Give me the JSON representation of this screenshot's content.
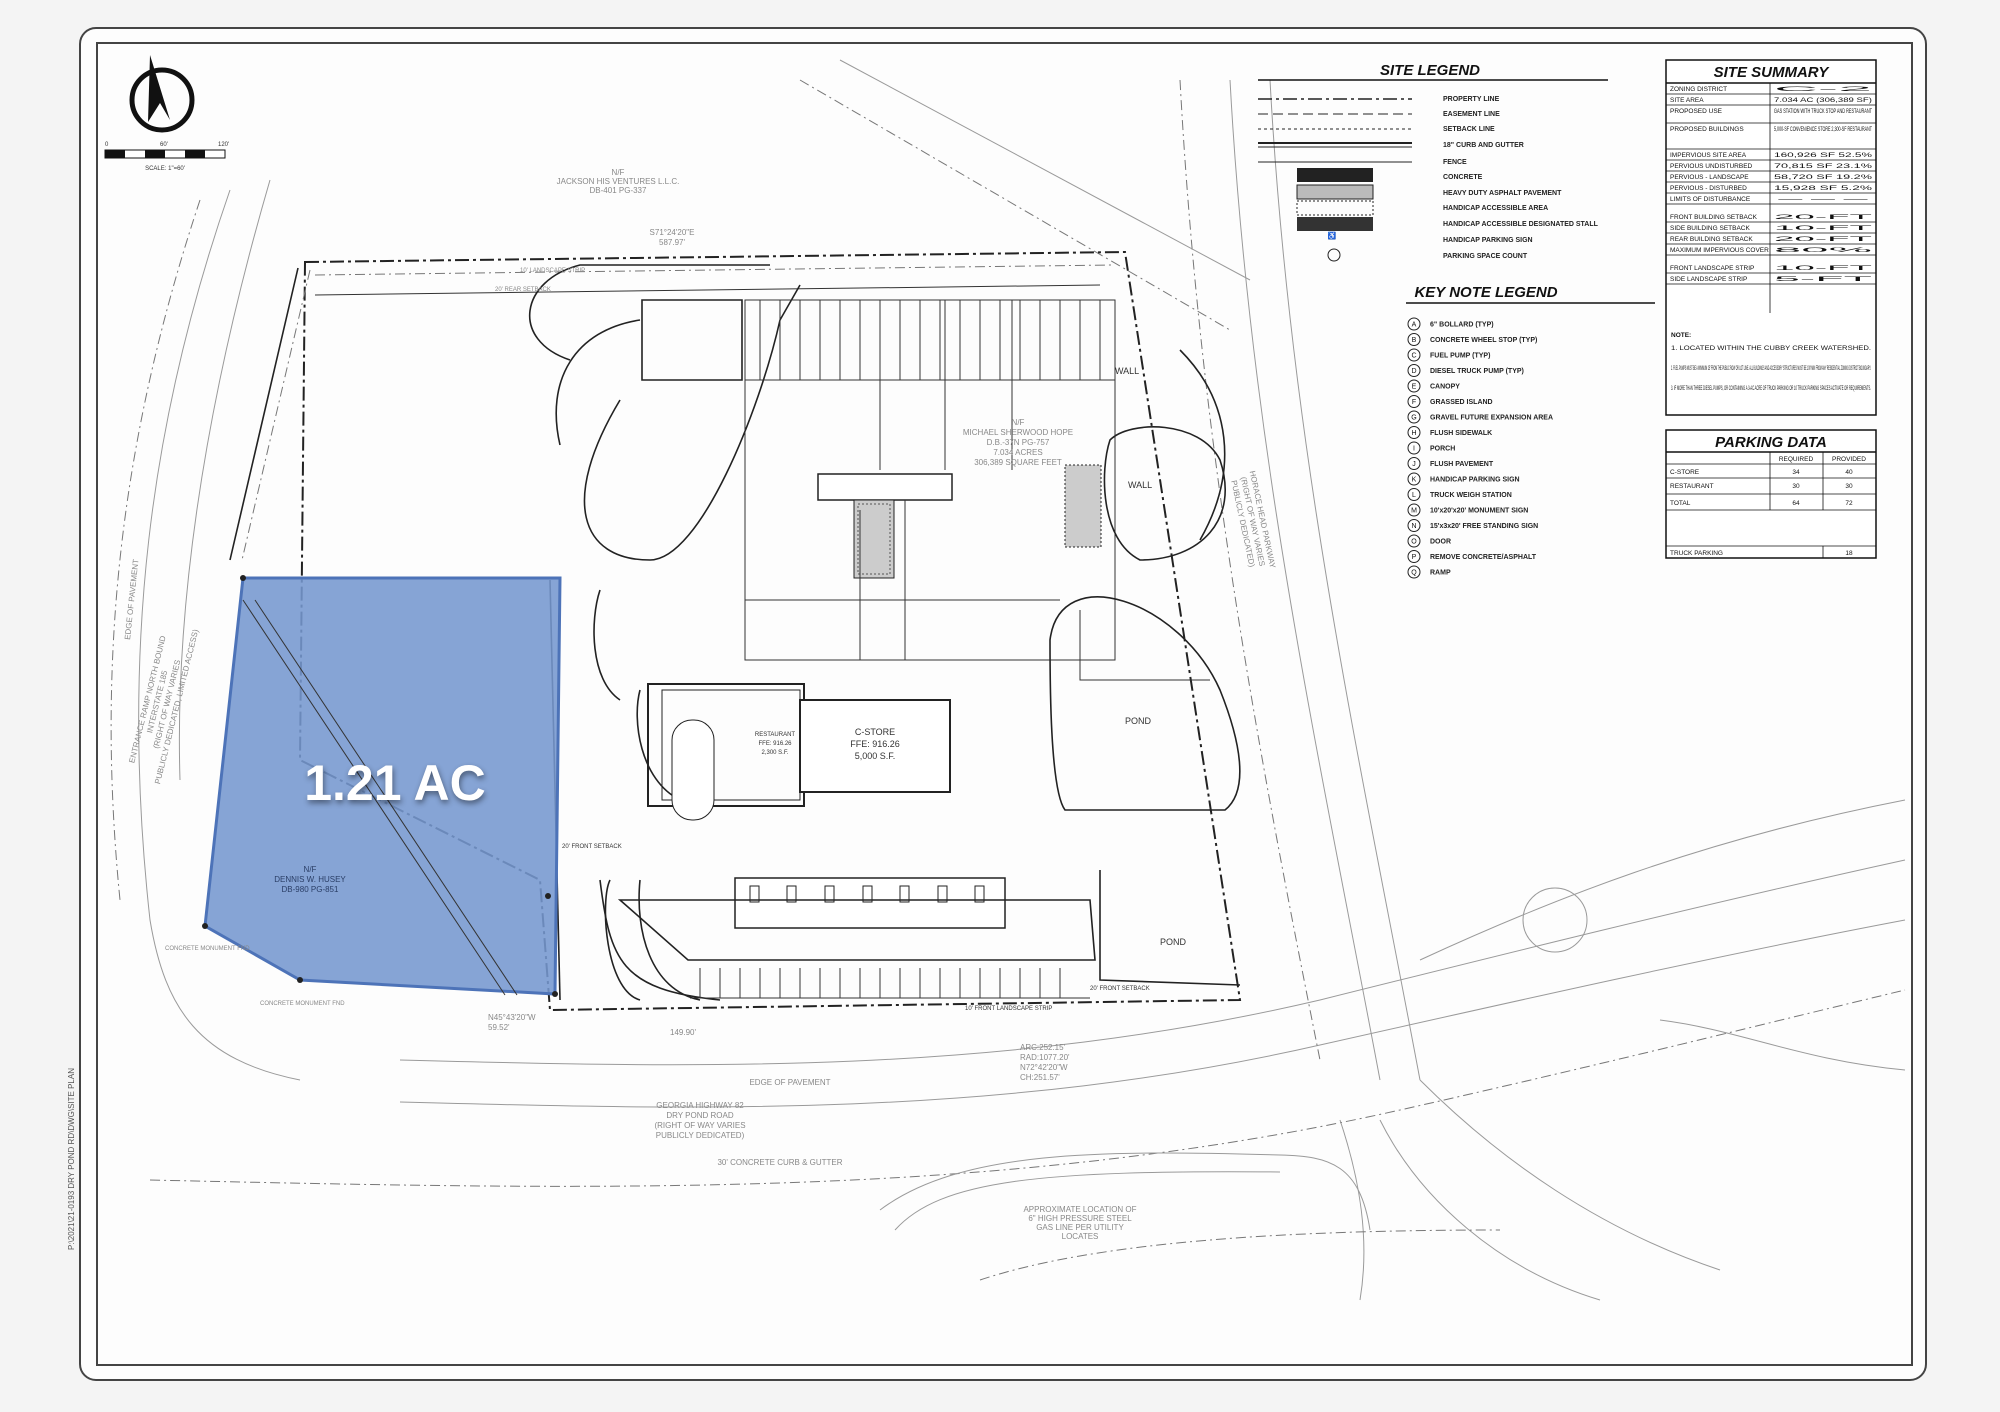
{
  "parcel": {
    "area_label": "1.21 AC",
    "highlight_color": "#7597cf",
    "owner_label": "N/F",
    "owner_name": "DENNIS W. HUSEY",
    "owner_deed": "DB-980 PG-851"
  },
  "site_legend": {
    "title": "SITE LEGEND",
    "items": [
      "PROPERTY LINE",
      "EASEMENT LINE",
      "SETBACK LINE",
      "18\" CURB AND GUTTER",
      "FENCE",
      "CONCRETE",
      "HEAVY DUTY ASPHALT PAVEMENT",
      "HANDICAP ACCESSIBLE AREA",
      "HANDICAP ACCESSIBLE DESIGNATED STALL",
      "HANDICAP PARKING SIGN",
      "PARKING SPACE COUNT"
    ]
  },
  "key_note_legend": {
    "title": "KEY NOTE LEGEND",
    "items": [
      {
        "key": "A",
        "label": "6\" BOLLARD (TYP)"
      },
      {
        "key": "B",
        "label": "CONCRETE WHEEL STOP (TYP)"
      },
      {
        "key": "C",
        "label": "FUEL PUMP (TYP)"
      },
      {
        "key": "D",
        "label": "DIESEL TRUCK PUMP (TYP)"
      },
      {
        "key": "E",
        "label": "CANOPY"
      },
      {
        "key": "F",
        "label": "GRASSED ISLAND"
      },
      {
        "key": "G",
        "label": "GRAVEL FUTURE EXPANSION AREA"
      },
      {
        "key": "H",
        "label": "FLUSH SIDEWALK"
      },
      {
        "key": "I",
        "label": "PORCH"
      },
      {
        "key": "J",
        "label": "FLUSH PAVEMENT"
      },
      {
        "key": "K",
        "label": "HANDICAP PARKING SIGN"
      },
      {
        "key": "L",
        "label": "TRUCK WEIGH STATION"
      },
      {
        "key": "M",
        "label": "10'x20'x20' MONUMENT SIGN"
      },
      {
        "key": "N",
        "label": "15'x3x20' FREE STANDING SIGN"
      },
      {
        "key": "O",
        "label": "DOOR"
      },
      {
        "key": "P",
        "label": "REMOVE CONCRETE/ASPHALT"
      },
      {
        "key": "Q",
        "label": "RAMP"
      }
    ]
  },
  "site_summary": {
    "title": "SITE SUMMARY",
    "rows": [
      {
        "label": "ZONING DISTRICT",
        "value": "C-2"
      },
      {
        "label": "SITE AREA",
        "value": "7.034 AC (306,389 SF)"
      },
      {
        "label": "PROPOSED USE",
        "value": "GAS STATION WITH TRUCK STOP AND RESTAURANT"
      },
      {
        "label": "PROPOSED BUILDINGS",
        "value": "5,000-SF CONVENIENCE STORE 2,300-SF RESTAURANT"
      },
      {
        "label": "IMPERVIOUS SITE AREA",
        "value": "160,926 SF 52.5%"
      },
      {
        "label": "PERVIOUS UNDISTURBED",
        "value": "70,815 SF 23.1%"
      },
      {
        "label": "PERVIOUS - LANDSCAPE",
        "value": "58,720 SF 19.2%"
      },
      {
        "label": "PERVIOUS - DISTURBED",
        "value": "15,928 SF 5.2%"
      },
      {
        "label": "LIMITS OF DISTURBANCE",
        "value": "---"
      },
      {
        "label": "FRONT BUILDING SETBACK",
        "value": "20-FT"
      },
      {
        "label": "SIDE BUILDING SETBACK",
        "value": "10-FT"
      },
      {
        "label": "REAR BUILDING SETBACK",
        "value": "20-FT"
      },
      {
        "label": "MAXIMUM IMPERVIOUS COVER",
        "value": "80%"
      },
      {
        "label": "FRONT LANDSCAPE STRIP",
        "value": "10-FT"
      },
      {
        "label": "SIDE LANDSCAPE STRIP",
        "value": "5-FT"
      }
    ],
    "notes_title": "NOTE:",
    "notes": [
      "1. LOCATED WITHIN THE CUBBY CREEK WATERSHED.",
      "2. FUEL PUMPS MUST BE A MINIMUM 25' FROM THE PUBLIC ROW OR LOT LINE. ALL BUILDINGS AND ACCESSORY STRUCTURES MUST BE 100' MIN FROM ANY RESIDENTIAL ZONING DISTRICT BOUNDARY.",
      "3. IF MORE THAN THREE DIESEL PUMPS, OR CONTAINING A 3-AC ACRE OF TRUCK PARKING OR 10 TRUCK PARKING SPACES ACTIVATE OR REQUIREMENTS."
    ]
  },
  "parking_data": {
    "title": "PARKING DATA",
    "columns": [
      "",
      "REQUIRED",
      "PROVIDED"
    ],
    "rows": [
      [
        "C-STORE",
        "34",
        "40"
      ],
      [
        "RESTAURANT",
        "30",
        "30"
      ],
      [
        "TOTAL",
        "64",
        "72"
      ]
    ],
    "truck_label": "TRUCK PARKING",
    "truck_value": "18"
  },
  "scale": {
    "label": "SCALE: 1\"=60'",
    "ticks": [
      "0",
      "60'",
      "120'"
    ]
  },
  "plan_labels": {
    "north_owner_nf": "N/F",
    "north_owner": "JACKSON HIS VENTURES L.L.C.",
    "north_deed": "DB-401 PG-337",
    "north_bearing": "S71°24'20\"E",
    "north_distance": "587.97'",
    "site_owner_nf": "N/F",
    "site_owner": "MICHAEL SHERWOOD HOPE",
    "site_deed": "D.B.-37N PG-757",
    "site_acres": "7.034 ACRES",
    "site_sf": "306,389 SQUARE FEET",
    "west_road_1": "ENTRANCE RAMP NORTH BOUND",
    "west_road_2": "INTERSTATE 185",
    "west_road_3": "(RIGHT OF WAY VARIES",
    "west_road_4": "PUBLICLY DEDICATED, LIMITED ACCESS)",
    "west_edge": "EDGE OF PAVEMENT",
    "east_road_1": "HORACE HEAD PARKWAY",
    "east_road_2": "(RIGHT OF WAY VARIES",
    "east_road_3": "PUBLICLY DEDICATED)",
    "south_road_1": "GEORGIA HIGHWAY 82",
    "south_road_2": "DRY POND ROAD",
    "south_road_3": "(RIGHT OF WAY VARIES",
    "south_road_4": "PUBLICLY DEDICATED)",
    "south_curb": "30' CONCRETE CURB & GUTTER",
    "south_edge": "EDGE OF PAVEMENT",
    "arc_1": "ARC:252.15'",
    "arc_2": "RAD:1077.20'",
    "arc_3": "N72°42'20\"W",
    "arc_4": "CH:251.57'",
    "rear_setback": "20' REAR SETBACK",
    "rear_landscape": "10' LANDSCAPE STRIP",
    "front_setback": "20' FRONT SETBACK",
    "front_setback_2": "20' FRONT SETBACK",
    "front_landscape": "10' FRONT LANDSCAPE STRIP",
    "cstore_1": "C-STORE",
    "cstore_2": "FFE: 916.26",
    "cstore_3": "5,000 S.F.",
    "rest_1": "RESTAURANT",
    "rest_2": "FFE: 916.26",
    "rest_3": "2,300 S.F.",
    "pond_1": "POND",
    "pond_2": "POND",
    "wall_1": "WALL",
    "wall_2": "WALL",
    "gas_note_1": "APPROXIMATE LOCATION OF",
    "gas_note_2": "6\" HIGH PRESSURE STEEL",
    "gas_note_3": "GAS LINE PER UTILITY",
    "gas_note_4": "LOCATES",
    "monument_1": "CONCRETE MONUMENT FND",
    "monument_2": "CONCRETE MONUMENT FND",
    "side_bearing": "N45°43'20\"W",
    "side_dist": "59.52'",
    "front_dist": "149.90'"
  },
  "sheet_path": "P:\\2021\\21-0193 DRY POND RD\\DWG\\SITE PLAN"
}
